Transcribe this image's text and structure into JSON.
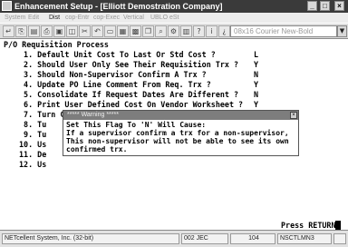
{
  "window": {
    "title": "Enhancement Setup - [Elliott Demostration Company]",
    "controls": [
      "_",
      "□",
      "×"
    ]
  },
  "menu": {
    "items": [
      "System",
      "Edit",
      "Dist",
      "cop-Entr",
      "cop-Exec",
      "Vertical",
      "UBLO",
      "eSt"
    ]
  },
  "toolbar": {
    "font_select": "08x16 Courier New-Bold",
    "dropdown_arrow": "▼",
    "icons": [
      "return-icon",
      "copy-icon",
      "paste-icon",
      "print-icon",
      "image-icon",
      "save-icon",
      "cut-icon",
      "undo-icon",
      "window-icon",
      "tile-icon",
      "grid-icon",
      "cascade-icon",
      "zoom-icon",
      "settings-icon",
      "chart-icon",
      "help-icon",
      "info-icon",
      "question-icon"
    ]
  },
  "screen": {
    "heading": "P/O Requisition Process",
    "options": [
      {
        "label": " 1. Default Unit Cost To Last Or Std Cost ?",
        "value": "L"
      },
      {
        "label": " 2. Should User Only See Their Requisition Trx ?",
        "value": "Y"
      },
      {
        "label": " 3. Should Non-Supervisor Confirm A Trx ?",
        "value": "N"
      },
      {
        "label": " 4. Update PO Line Comment From Req. Trx ?",
        "value": "Y"
      },
      {
        "label": " 5. Consolidate If Request Dates Are Different ?",
        "value": "N"
      },
      {
        "label": " 6. Print User Defined Cost On Vendor Worksheet ?",
        "value": "Y"
      },
      {
        "label": " 7. Turn COP Orders Into Requisition ?",
        "value": "Y"
      },
      {
        "label": " 8. Tu",
        "value": ""
      },
      {
        "label": " 9. Tu",
        "value": ""
      },
      {
        "label": "10. Us",
        "value": ""
      },
      {
        "label": "11. De",
        "value": ""
      },
      {
        "label": "12. Us",
        "value": ""
      }
    ],
    "prompt": "Press RETURN"
  },
  "dialog": {
    "title": "***** Warning *****",
    "close": "×",
    "lines": [
      "Set This Flag To 'N' Will Cause:",
      "If a supervisor confirm a trx for a non-supervisor,",
      "This non-supervisor will not be able to see its own",
      "confirmed trx."
    ]
  },
  "statusbar": {
    "fields": [
      "NETcellent System, Inc. (32-bit)",
      "002 JEC",
      "104",
      "NSCTLMN3"
    ]
  },
  "colors": {
    "titlebar": "#3a3a3a",
    "dialog_title": "#7d7d7d"
  }
}
